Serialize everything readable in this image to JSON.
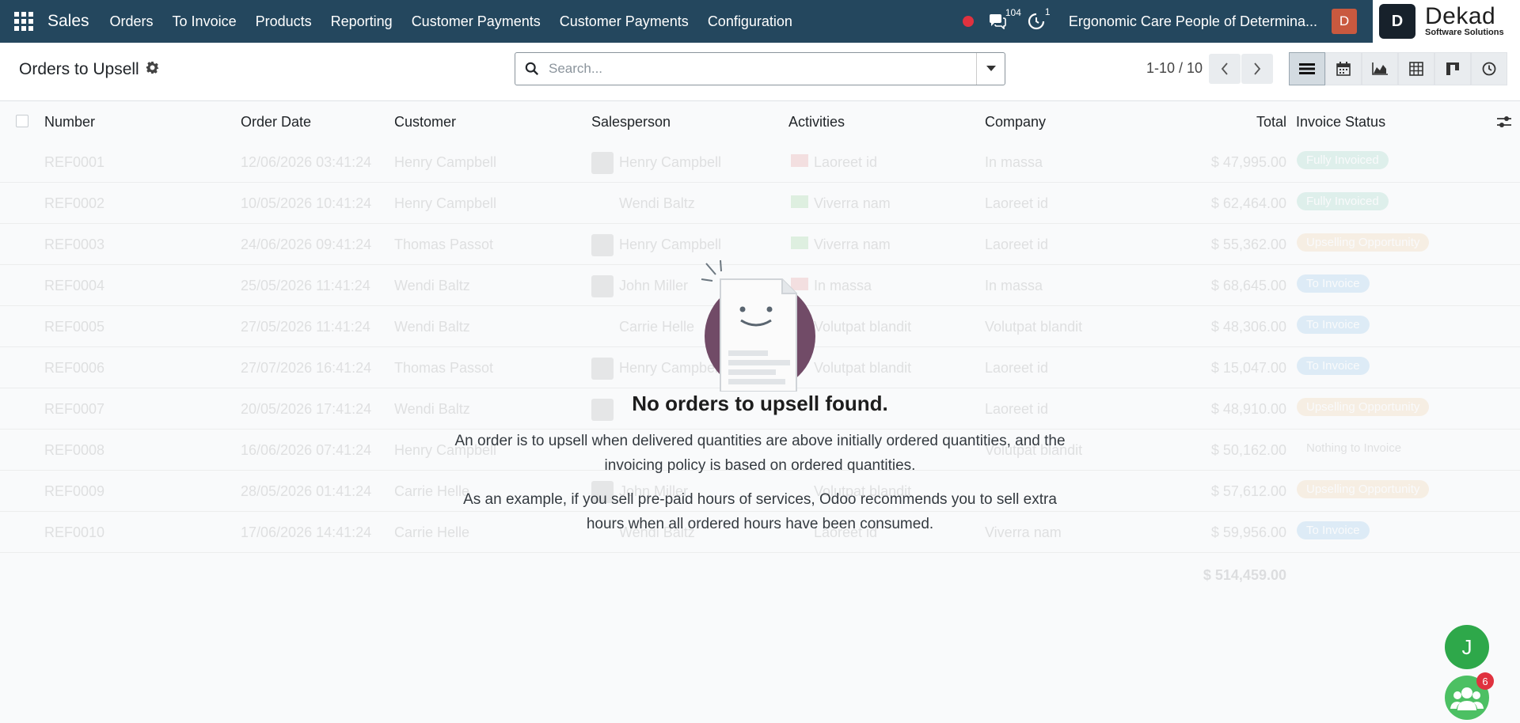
{
  "navbar": {
    "brand": "Sales",
    "menu": [
      "Orders",
      "To Invoice",
      "Products",
      "Reporting",
      "Customer Payments",
      "Customer Payments",
      "Configuration"
    ],
    "messages_count": "104",
    "activities_count": "1",
    "company": "Ergonomic Care People of Determina...",
    "user_initial": "D",
    "logo": {
      "mark": "D",
      "name": "Dekad",
      "tagline": "Software Solutions"
    }
  },
  "control_panel": {
    "title": "Orders to Upsell",
    "search_placeholder": "Search...",
    "pager": "1-10 / 10",
    "views": [
      "list-view-icon",
      "calendar-view-icon",
      "graph-view-icon",
      "pivot-view-icon",
      "kanban-view-icon",
      "activity-view-icon"
    ]
  },
  "list": {
    "columns": [
      "Number",
      "Order Date",
      "Customer",
      "Salesperson",
      "Activities",
      "Company",
      "Total",
      "Invoice Status"
    ],
    "rows": [
      {
        "number": "REF0001",
        "date": "12/06/2026 03:41:24",
        "customer": "Henry Campbell",
        "salesperson": "Henry Campbell",
        "activity": "Laoreet id",
        "company": "In massa",
        "total": "$ 47,995.00",
        "status": "Fully Invoiced"
      },
      {
        "number": "REF0002",
        "date": "10/05/2026 10:41:24",
        "customer": "Henry Campbell",
        "salesperson": "Wendi Baltz",
        "activity": "Viverra nam",
        "company": "Laoreet id",
        "total": "$ 62,464.00",
        "status": "Fully Invoiced"
      },
      {
        "number": "REF0003",
        "date": "24/06/2026 09:41:24",
        "customer": "Thomas Passot",
        "salesperson": "Henry Campbell",
        "activity": "Viverra nam",
        "company": "Laoreet id",
        "total": "$ 55,362.00",
        "status": "Upselling Opportunity"
      },
      {
        "number": "REF0004",
        "date": "25/05/2026 11:41:24",
        "customer": "Wendi Baltz",
        "salesperson": "John Miller",
        "activity": "In massa",
        "company": "In massa",
        "total": "$ 68,645.00",
        "status": "To Invoice"
      },
      {
        "number": "REF0005",
        "date": "27/05/2026 11:41:24",
        "customer": "Wendi Baltz",
        "salesperson": "Carrie Helle",
        "activity": "Volutpat blandit",
        "company": "Volutpat blandit",
        "total": "$ 48,306.00",
        "status": "To Invoice"
      },
      {
        "number": "REF0006",
        "date": "27/07/2026 16:41:24",
        "customer": "Thomas Passot",
        "salesperson": "Henry Campbell",
        "activity": "Volutpat blandit",
        "company": "Laoreet id",
        "total": "$ 15,047.00",
        "status": "To Invoice"
      },
      {
        "number": "REF0007",
        "date": "20/05/2026 17:41:24",
        "customer": "Wendi Baltz",
        "salesperson": "Henry Campbell",
        "activity": "",
        "company": "Laoreet id",
        "total": "$ 48,910.00",
        "status": "Upselling Opportunity"
      },
      {
        "number": "REF0008",
        "date": "16/06/2026 07:41:24",
        "customer": "Henry Campbell",
        "salesperson": "",
        "activity": "",
        "company": "Volutpat blandit",
        "total": "$ 50,162.00",
        "status": "Nothing to Invoice"
      },
      {
        "number": "REF0009",
        "date": "28/05/2026 01:41:24",
        "customer": "Carrie Helle",
        "salesperson": "John Miller",
        "activity": "Volutpat blandit",
        "company": "",
        "total": "$ 57,612.00",
        "status": "Upselling Opportunity"
      },
      {
        "number": "REF0010",
        "date": "17/06/2026 14:41:24",
        "customer": "Carrie Helle",
        "salesperson": "Wendi Baltz",
        "activity": "Laoreet id",
        "company": "Viverra nam",
        "total": "$ 59,956.00",
        "status": "To Invoice"
      }
    ],
    "grand_total": "$ 514,459.00"
  },
  "empty_state": {
    "title": "No orders to upsell found.",
    "text1": "An order is to upsell when delivered quantities are above initially ordered quantities, and the invoicing policy is based on ordered quantities.",
    "text2": "As an example, if you sell pre-paid hours of services, Odoo recommends you to sell extra hours when all ordered hours have been consumed."
  },
  "floating": {
    "chat_initial": "J",
    "team_badge": "6"
  },
  "colors": {
    "navbar": "#24475e",
    "accent": "#714b67",
    "online": "#2ea84a"
  }
}
